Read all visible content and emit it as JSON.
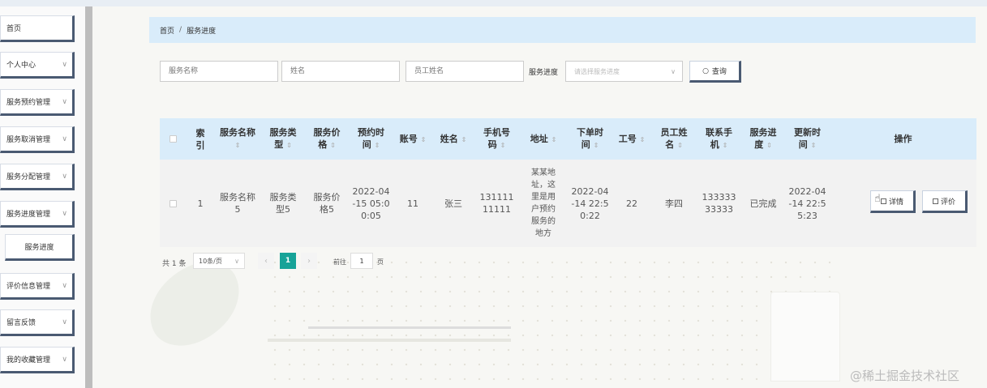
{
  "sidebar": {
    "items": [
      {
        "label": "首页",
        "chevron": false
      },
      {
        "label": "个人中心",
        "chevron": true
      },
      {
        "label": "服务预约管理",
        "chevron": true
      },
      {
        "label": "服务取消管理",
        "chevron": true
      },
      {
        "label": "服务分配管理",
        "chevron": true
      },
      {
        "label": "服务进度管理",
        "chevron": true
      },
      {
        "label": "服务进度",
        "chevron": false,
        "sub": true
      },
      {
        "label": "评价信息管理",
        "chevron": true
      },
      {
        "label": "留言反馈",
        "chevron": true
      },
      {
        "label": "我的收藏管理",
        "chevron": true
      }
    ]
  },
  "breadcrumb": {
    "home": "首页",
    "separator": "/",
    "current": "服务进度"
  },
  "filters": {
    "service_name_placeholder": "服务名称",
    "name_placeholder": "姓名",
    "employee_name_placeholder": "员工姓名",
    "progress_label": "服务进度",
    "progress_placeholder": "请选择服务进度",
    "query_label": "查询"
  },
  "table": {
    "headers": {
      "index": [
        "索",
        "引"
      ],
      "service_name": [
        "服务名称"
      ],
      "service_type": [
        "服务类",
        "型"
      ],
      "service_price": [
        "服务价",
        "格"
      ],
      "appointment_time": [
        "预约时",
        "间"
      ],
      "account": [
        "账号"
      ],
      "name": [
        "姓名"
      ],
      "phone": [
        "手机号",
        "码"
      ],
      "address": [
        "地址"
      ],
      "order_time": [
        "下单时",
        "间"
      ],
      "employee_id": [
        "工号"
      ],
      "employee_name": [
        "员工姓",
        "名"
      ],
      "contact_phone": [
        "联系手",
        "机"
      ],
      "progress": [
        "服务进",
        "度"
      ],
      "update_time": [
        "更新时",
        "间"
      ],
      "actions": "操作"
    },
    "rows": [
      {
        "index": "1",
        "service_name": "服务名称5",
        "service_type": "服务类型5",
        "service_price": "服务价格5",
        "appointment_time": "2022-04-15 05:00:05",
        "account": "11",
        "name": "张三",
        "phone": "13111111111",
        "address": "某某地址，这里是用户预约服务的地方",
        "order_time": "2022-04-14 22:50:22",
        "employee_id": "22",
        "employee_name": "李四",
        "contact_phone": "13333333333",
        "progress": "已完成",
        "update_time": "2022-04-14 22:55:23",
        "detail_label": "详情",
        "review_label": "评价"
      }
    ]
  },
  "pagination": {
    "total": "共 1 条",
    "page_size": "10条/页",
    "current_page": "1",
    "goto_label": "前往",
    "goto_value": "1",
    "page_unit": "页"
  },
  "watermark": "@稀土掘金技术社区"
}
